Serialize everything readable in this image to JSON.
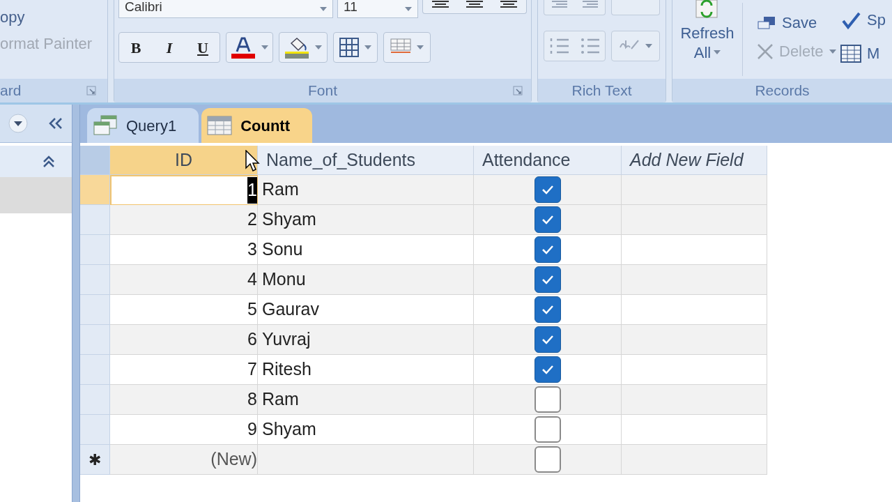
{
  "ribbon": {
    "clipboard": {
      "label": "ard",
      "items": [
        {
          "label": "opy",
          "disabled": false
        },
        {
          "label": "ormat Painter",
          "disabled": true
        }
      ]
    },
    "font": {
      "label": "Font",
      "font_name": "Calibri",
      "font_size": "11",
      "format_buttons": [
        "B",
        "I",
        "U"
      ]
    },
    "rich_text": {
      "label": "Rich Text"
    },
    "records": {
      "label": "Records",
      "refresh": "Refresh",
      "refresh_sub": "All",
      "items": [
        {
          "label": "Save",
          "kind": "save",
          "disabled": false
        },
        {
          "label": "Delete",
          "kind": "delete",
          "disabled": true
        }
      ],
      "side_items": [
        {
          "label": "Sp",
          "kind": "spelling"
        },
        {
          "label": "M",
          "kind": "more"
        }
      ]
    }
  },
  "tabs": [
    {
      "label": "Query1",
      "kind": "query",
      "selected": false
    },
    {
      "label": "Countt",
      "kind": "table",
      "selected": true
    }
  ],
  "table": {
    "columns": [
      {
        "label": "ID",
        "selected": true,
        "italic": false
      },
      {
        "label": "Name_of_Students",
        "selected": false,
        "italic": false
      },
      {
        "label": "Attendance",
        "selected": false,
        "italic": false
      },
      {
        "label": "Add New Field",
        "selected": false,
        "italic": true
      }
    ],
    "rows": [
      {
        "id": "1",
        "name": "Ram",
        "attendance": true,
        "selected": true
      },
      {
        "id": "2",
        "name": "Shyam",
        "attendance": true,
        "selected": false
      },
      {
        "id": "3",
        "name": "Sonu",
        "attendance": true,
        "selected": false
      },
      {
        "id": "4",
        "name": "Monu",
        "attendance": true,
        "selected": false
      },
      {
        "id": "5",
        "name": "Gaurav",
        "attendance": true,
        "selected": false
      },
      {
        "id": "6",
        "name": "Yuvraj",
        "attendance": true,
        "selected": false
      },
      {
        "id": "7",
        "name": "Ritesh",
        "attendance": true,
        "selected": false
      },
      {
        "id": "8",
        "name": "Ram",
        "attendance": false,
        "selected": false
      },
      {
        "id": "9",
        "name": "Shyam",
        "attendance": false,
        "selected": false
      }
    ],
    "new_row": {
      "marker": "✱",
      "id": "(New)",
      "attendance": false
    }
  }
}
